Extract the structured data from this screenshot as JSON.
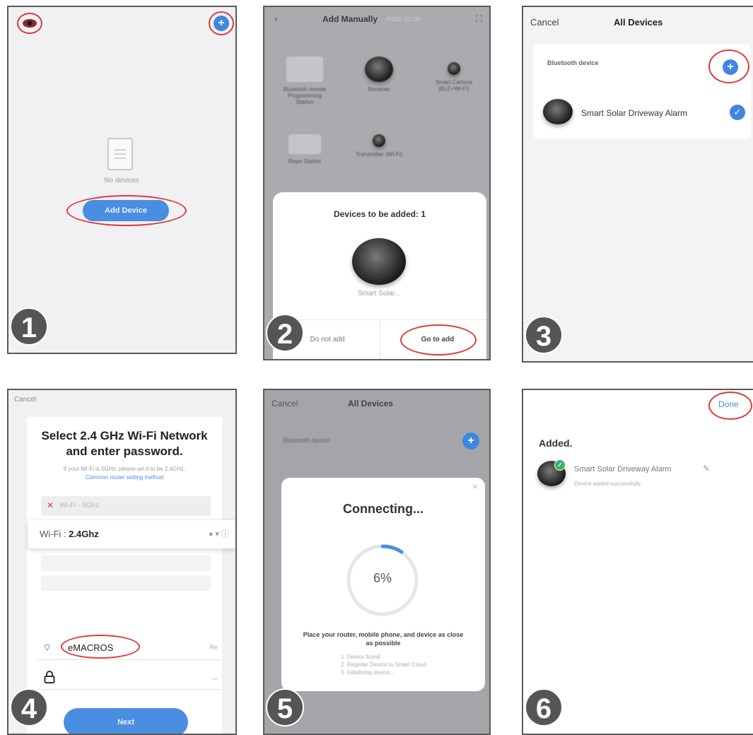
{
  "step_numbers": [
    "1",
    "2",
    "3",
    "4",
    "5",
    "6"
  ],
  "panel1": {
    "no_devices_text": "No devices",
    "add_device_button": "Add Device"
  },
  "panel2": {
    "header_title": "Add Manually",
    "header_subtitle": "Auto Scan",
    "grid_items": [
      "Bluetooth remote Programming Station",
      "Receiver",
      "Smart Camera (BLE+Wi-Fi)",
      "Repo Station",
      "Transmitter (Wi-Fi)"
    ],
    "sheet_title": "Devices to be added: 1",
    "device_label": "Smart Solar...",
    "do_not_add": "Do not add",
    "go_to_add": "Go to add"
  },
  "panel3": {
    "cancel": "Cancel",
    "title": "All Devices",
    "section_label": "Bluetooth device",
    "device_name": "Smart Solar Driveway Alarm"
  },
  "panel4": {
    "cancel": "Cancel",
    "heading_line1": "Select 2.4 GHz Wi-Fi Network",
    "heading_line2": "and enter password.",
    "hint_text": "If your Wi-Fi is 5GHz, please set it to be 2.4GHz.",
    "hint_link": "Common router setting method",
    "wifi_5g_label": "Wi-Fi - 5Ghz",
    "wifi_label": "Wi-Fi : ",
    "wifi_value": "2.4Ghz",
    "ssid": "eMACROS",
    "ssid_right": "Re",
    "next_button": "Next"
  },
  "panel5": {
    "cancel": "Cancel",
    "title": "All Devices",
    "section_label": "Bluetooth device",
    "dialog_title": "Connecting...",
    "progress": "6%",
    "message": "Place your router, mobile phone, and device as close as possible",
    "steps": [
      "1. Device found",
      "2. Register Device to Smart Cloud",
      "3. Initializing device..."
    ]
  },
  "panel6": {
    "done": "Done",
    "added": "Added.",
    "device_name": "Smart Solar Driveway Alarm",
    "device_status": "Device added successfully"
  },
  "colors": {
    "accent_blue": "#4a8ee2",
    "highlight_red": "#e03a3a",
    "success_green": "#35b46a"
  }
}
